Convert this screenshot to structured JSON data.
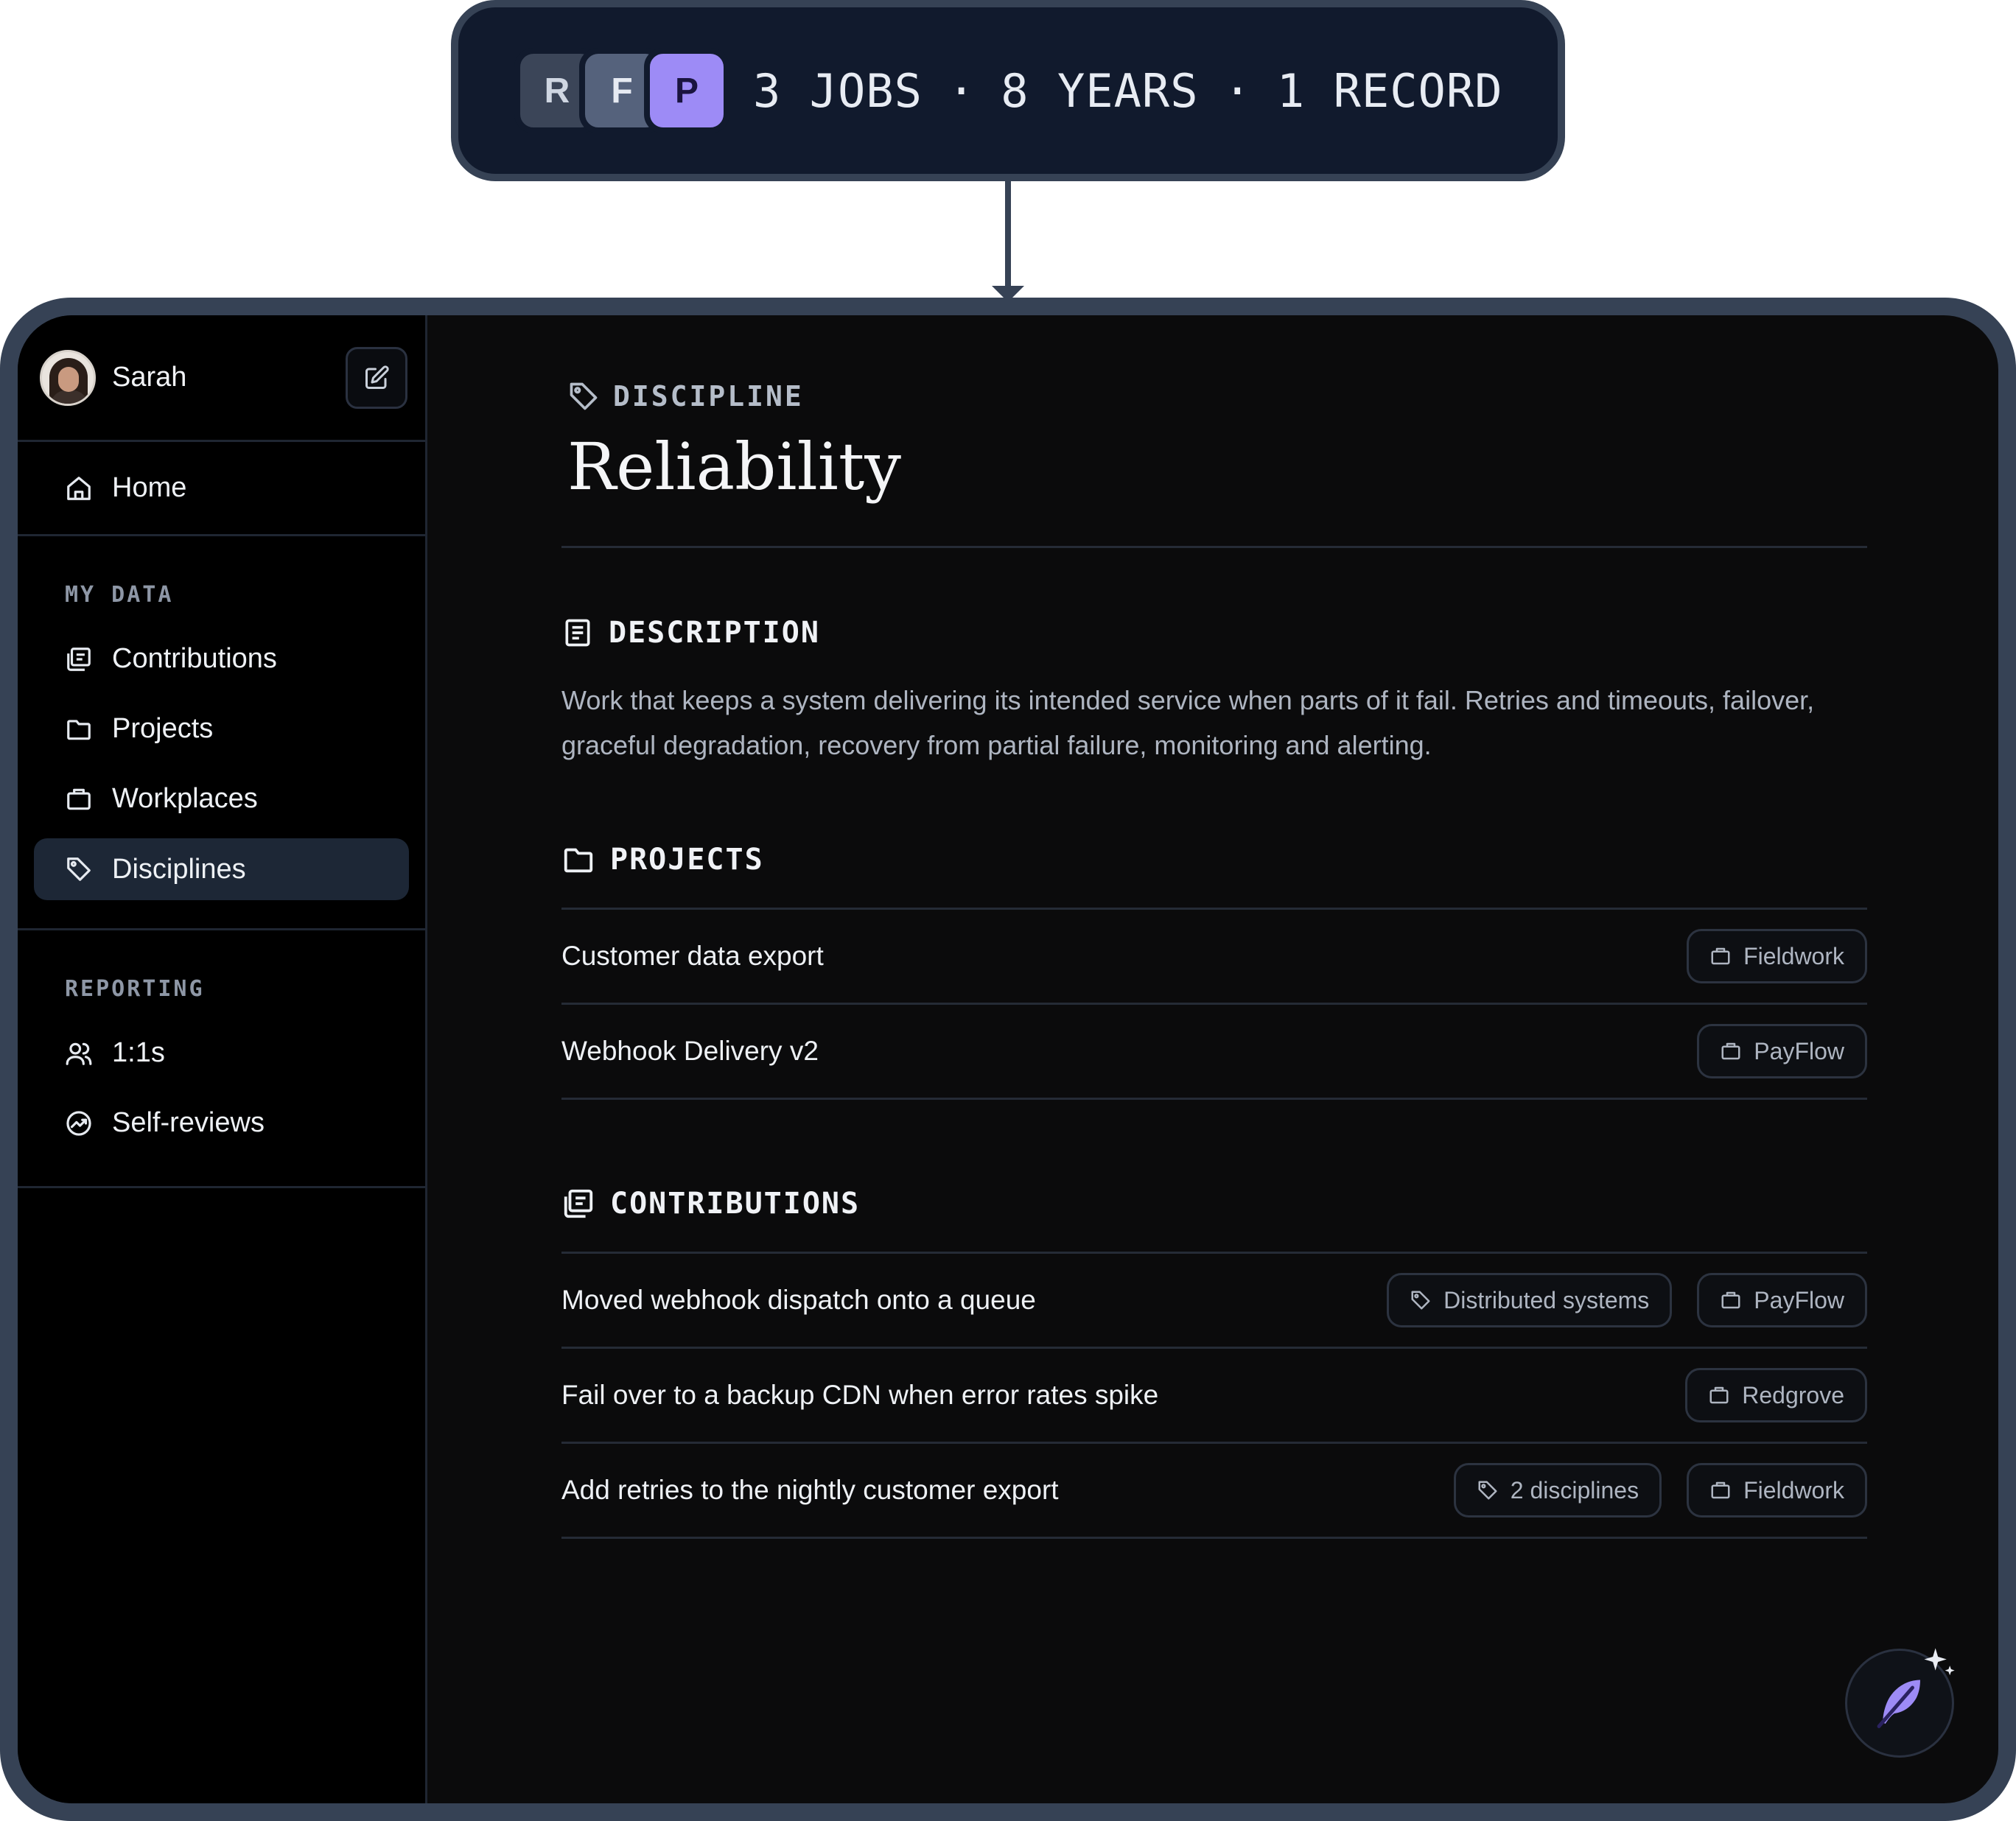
{
  "stats": {
    "avatars": [
      "R",
      "F",
      "P"
    ],
    "jobs": "3 JOBS",
    "years": "8 YEARS",
    "record": "1 RECORD",
    "separator": "·"
  },
  "user": {
    "name": "Sarah"
  },
  "sidebar": {
    "home": "Home",
    "sections": [
      {
        "title": "MY DATA",
        "items": [
          "Contributions",
          "Projects",
          "Workplaces",
          "Disciplines"
        ]
      },
      {
        "title": "REPORTING",
        "items": [
          "1:1s",
          "Self-reviews"
        ]
      }
    ]
  },
  "page": {
    "crumb": "DISCIPLINE",
    "title": "Reliability",
    "description_heading": "DESCRIPTION",
    "description": "Work that keeps a system delivering its intended service when parts of it fail. Retries and timeouts, failover, graceful degradation, recovery from partial failure, monitoring and alerting.",
    "projects_heading": "PROJECTS",
    "projects": [
      {
        "title": "Customer data export",
        "workplace": "Fieldwork"
      },
      {
        "title": "Webhook Delivery v2",
        "workplace": "PayFlow"
      }
    ],
    "contributions_heading": "CONTRIBUTIONS",
    "contributions": [
      {
        "title": "Moved webhook dispatch onto a queue",
        "discipline": "Distributed systems",
        "workplace": "PayFlow"
      },
      {
        "title": "Fail over to a backup CDN when error rates spike",
        "workplace": "Redgrove"
      },
      {
        "title": "Add retries to the nightly customer export",
        "discipline": "2 disciplines",
        "workplace": "Fieldwork"
      }
    ]
  },
  "colors": {
    "accent": "#9d8bf6",
    "frame": "#364255",
    "background": "#0b0b0c",
    "active_nav": "#1d2736"
  }
}
